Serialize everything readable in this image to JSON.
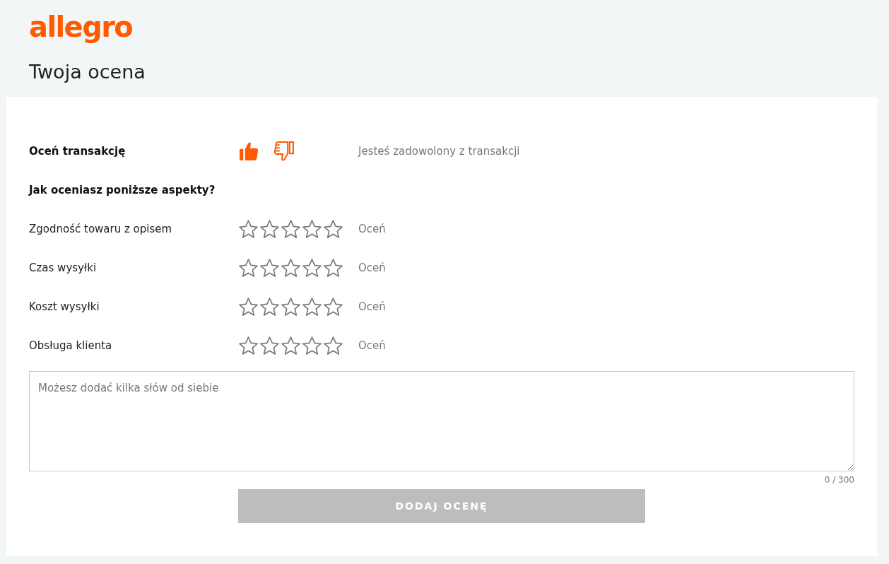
{
  "logo": "allegro",
  "title": "Twoja ocena",
  "transaction_rating": {
    "label": "Oceń transakcję",
    "options": [
      {
        "kind": "positive",
        "selected": true
      },
      {
        "kind": "negative",
        "selected": false
      }
    ],
    "status": "Jesteś zadowolony z transakcji"
  },
  "aspects_heading": "Jak oceniasz poniższe aspekty?",
  "aspects": [
    {
      "label": "Zgodność towaru z opisem",
      "stars": 0,
      "hint": "Oceń"
    },
    {
      "label": "Czas wysyłki",
      "stars": 0,
      "hint": "Oceń"
    },
    {
      "label": "Koszt wysyłki",
      "stars": 0,
      "hint": "Oceń"
    },
    {
      "label": "Obsługa klienta",
      "stars": 0,
      "hint": "Oceń"
    }
  ],
  "comment": {
    "placeholder": "Możesz dodać kilka słów od siebie",
    "counter": "0 / 300"
  },
  "submit_button": {
    "label": "DODAJ OCENĘ",
    "disabled": true
  }
}
